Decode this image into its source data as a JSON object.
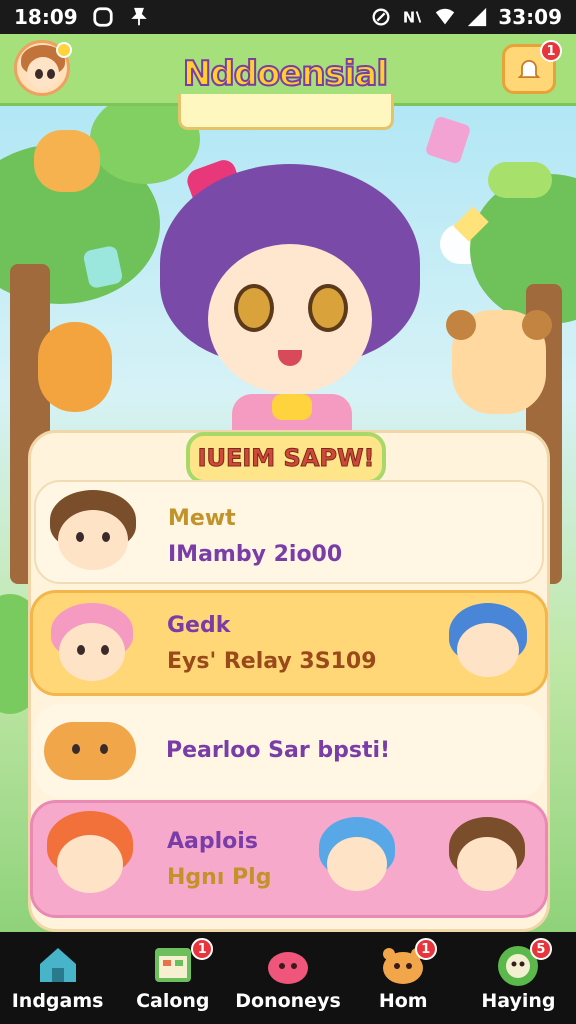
{
  "status_bar": {
    "time_left": "18:09",
    "time_right": "33:09"
  },
  "header": {
    "app_title": "Nddoensial",
    "notification_count": "1"
  },
  "panel": {
    "title": "IUEIM SAPW!"
  },
  "cards": [
    {
      "line1": "Mewt",
      "line2": "IMamby 2io00"
    },
    {
      "line1": "Gedk",
      "line2": "Eys' Relay 3S109"
    },
    {
      "line1": "Pearloo Sar bpsti!"
    },
    {
      "line1": "Aaplois",
      "line2": "Hgnı Plg"
    }
  ],
  "nav": [
    {
      "label": "Indgams",
      "badge": ""
    },
    {
      "label": "Calong",
      "badge": "1"
    },
    {
      "label": "Dononeys",
      "badge": ""
    },
    {
      "label": "Hom",
      "badge": "1"
    },
    {
      "label": "Haying",
      "badge": "5"
    }
  ],
  "colors": {
    "header_green": "#a5e07a",
    "card_yellow": "#ffd777",
    "card_pink": "#f7a9cc",
    "badge_red": "#e8343a",
    "mascot_hair": "#7a4aa8"
  }
}
